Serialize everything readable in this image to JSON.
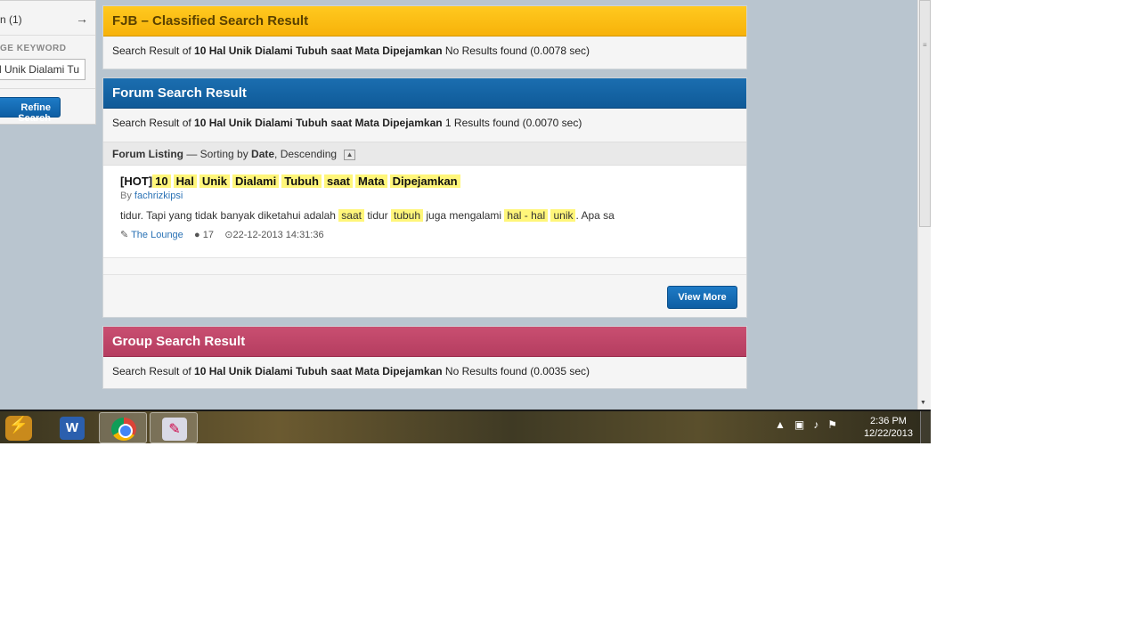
{
  "sidebar": {
    "row_label": "n (1)",
    "arrow_icon": "arrow-right-icon",
    "keyword_label": "GE KEYWORD",
    "keyword_value": "al Unik Dialami Tu",
    "refine_label": "Refine Search"
  },
  "fjb": {
    "title": "FJB – Classified Search Result",
    "prefix": "Search Result of ",
    "query": "10 Hal Unik Dialami Tubuh saat Mata Dipejamkan",
    "status": " No Results found (0.0078 sec)"
  },
  "forum": {
    "title": "Forum Search Result",
    "prefix": "Search Result of ",
    "query": "10 Hal Unik Dialami Tubuh saat Mata Dipejamkan",
    "status": " 1 Results found (0.0070 sec)",
    "listing": {
      "label": "Forum Listing",
      "dash": " — Sorting by ",
      "sort_field": "Date",
      "sort_order": ", Descending"
    },
    "result": {
      "tag": "[HOT]",
      "title_words": [
        "10",
        "Hal",
        "Unik",
        "Dialami",
        "Tubuh",
        "saat",
        "Mata",
        "Dipejamkan"
      ],
      "by_label": "By ",
      "author": "fachrizkipsi",
      "snippet": {
        "t1": "tidur. Tapi yang tidak banyak diketahui adalah ",
        "h1": "saat",
        "t2": " tidur ",
        "h2": "tubuh",
        "t3": " juga mengalami ",
        "h3": "hal - hal",
        "t4": " ",
        "h4": "unik",
        "t5": ". Apa sa"
      },
      "forum_name": "The Lounge",
      "replies": "17",
      "date": "22-12-2013 14:31:36"
    },
    "view_more": "View More"
  },
  "group": {
    "title": "Group Search Result",
    "prefix": "Search Result of ",
    "query": "10 Hal Unik Dialami Tubuh saat Mata Dipejamkan",
    "status": " No Results found (0.0035 sec)"
  },
  "taskbar": {
    "icons": [
      "start-icon",
      "word-icon",
      "chrome-icon",
      "paint-icon"
    ],
    "clock_time": "2:36 PM",
    "clock_date": "12/22/2013"
  }
}
